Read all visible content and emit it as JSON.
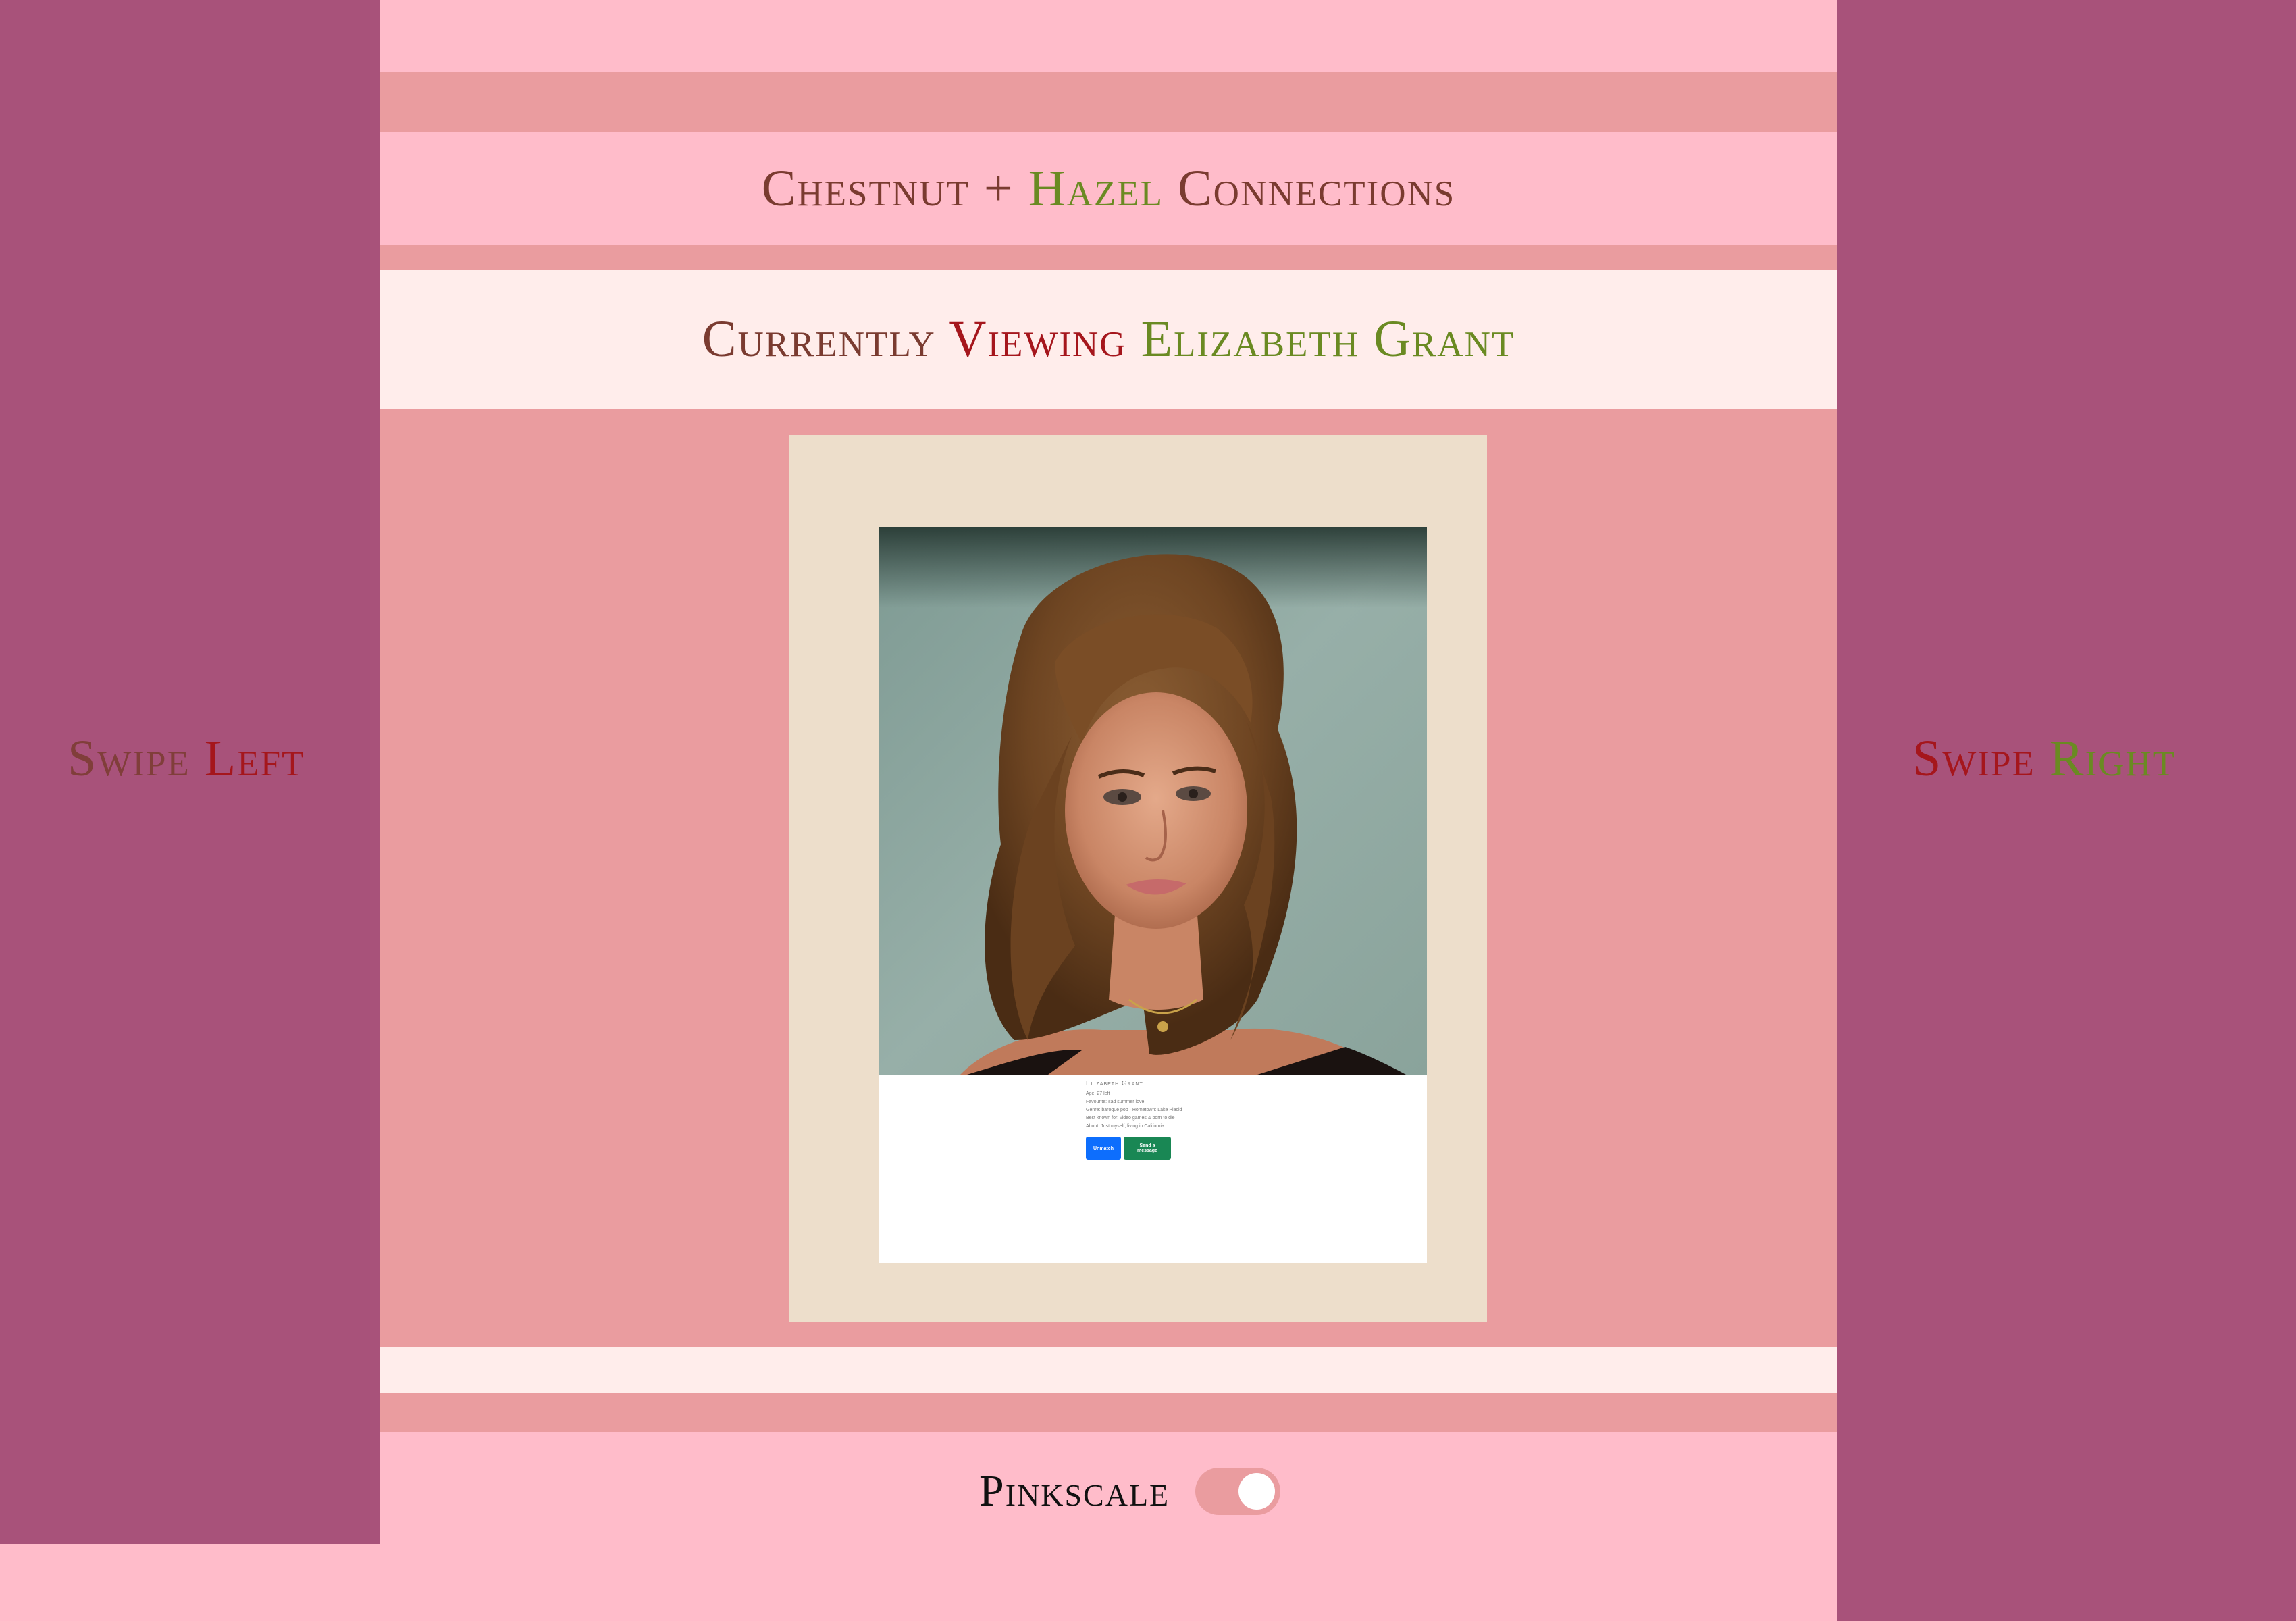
{
  "header": {
    "title_part1": "Chestnut +",
    "title_part2": "Hazel",
    "title_part3": "Connections"
  },
  "viewing": {
    "prefix": "Currently",
    "verb": "Viewing",
    "name": "Elizabeth Grant"
  },
  "swipe_left": {
    "word": "Swipe",
    "direction": "Left"
  },
  "swipe_right": {
    "word": "Swipe",
    "direction": "Right"
  },
  "profile": {
    "name": "Elizabeth Grant",
    "lines": [
      "Age: 27 left",
      "Favourite: sad summer love",
      "Genre: baroque pop · Hometown: Lake Placid",
      "Best known for: video games & born to die",
      "About: Just myself, living in California"
    ],
    "buttons": {
      "primary": "Unmatch",
      "secondary": "Send a message"
    }
  },
  "settings": {
    "pinkscale_label": "Pinkscale",
    "pinkscale_on": true
  },
  "colors": {
    "side_panel": "#A8527A",
    "page_pink": "#FFBCCA",
    "rose": "#EA9C9F",
    "cream": "#FFEDEB",
    "card_frame": "#EDDECB",
    "brown_text": "#7A3B30",
    "green_text": "#6A8A22",
    "red_text": "#A5161C"
  }
}
